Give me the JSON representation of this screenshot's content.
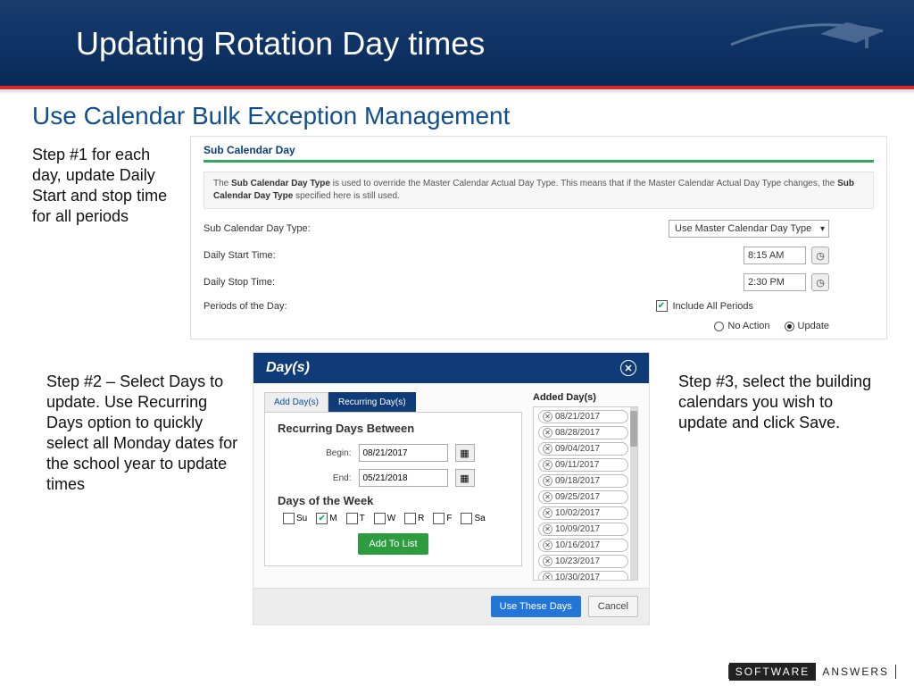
{
  "banner": {
    "title": "Updating Rotation Day times"
  },
  "subtitle": "Use Calendar Bulk Exception Management",
  "steps": {
    "s1": "Step #1 for each day, update Daily Start and stop time for all periods",
    "s2": "Step #2 – Select Days to update. Use Recurring Days option to quickly select all Monday dates for the school year to update times",
    "s3": "Step #3, select the building calendars you wish to update and click Save."
  },
  "panel1": {
    "heading": "Sub Calendar Day",
    "info_prefix": "The ",
    "info_b1": "Sub Calendar Day Type",
    "info_mid": " is used to override the Master Calendar Actual Day Type. This means that if the Master Calendar Actual Day Type changes, the ",
    "info_b2": "Sub Calendar Day Type",
    "info_suffix": " specified here is still used.",
    "labels": {
      "type": "Sub Calendar Day Type:",
      "start": "Daily Start Time:",
      "stop": "Daily Stop Time:",
      "periods": "Periods of the Day:"
    },
    "values": {
      "type_select": "Use Master Calendar Day Type",
      "start": "8:15 AM",
      "stop": "2:30 PM",
      "include_label": "Include All Periods"
    },
    "radios": {
      "no_action": "No Action",
      "update": "Update"
    }
  },
  "panel2": {
    "title": "Day(s)",
    "tabs": {
      "add": "Add Day(s)",
      "recurring": "Recurring Day(s)"
    },
    "rc_title": "Recurring Days Between",
    "begin_lbl": "Begin:",
    "end_lbl": "End:",
    "begin_val": "08/21/2017",
    "end_val": "05/21/2018",
    "dow_title": "Days of the Week",
    "dow": {
      "su": "Su",
      "m": "M",
      "t": "T",
      "w": "W",
      "r": "R",
      "f": "F",
      "sa": "Sa"
    },
    "add_btn": "Add To List",
    "added_head": "Added Day(s)",
    "added": [
      "08/21/2017",
      "08/28/2017",
      "09/04/2017",
      "09/11/2017",
      "09/18/2017",
      "09/25/2017",
      "10/02/2017",
      "10/09/2017",
      "10/16/2017",
      "10/23/2017",
      "10/30/2017"
    ],
    "use_btn": "Use These Days",
    "cancel_btn": "Cancel"
  },
  "footer": {
    "a": "SOFTWARE",
    "b": "ANSWERS"
  }
}
